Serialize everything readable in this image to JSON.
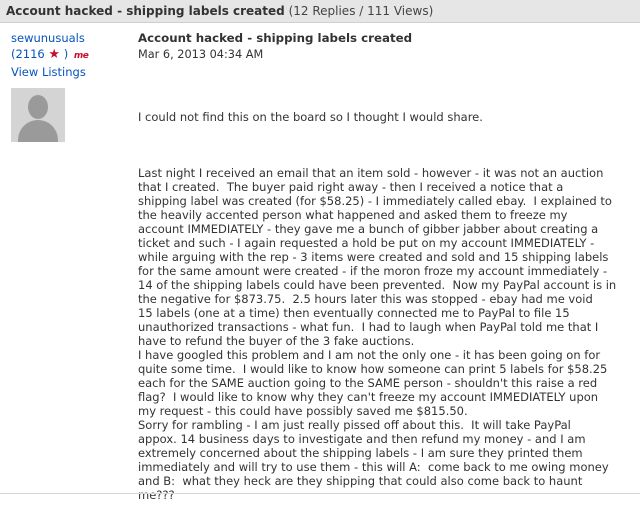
{
  "thread": {
    "title": "Account hacked - shipping labels created",
    "meta": "(12 Replies / 111 Views)"
  },
  "author": {
    "name": "sewunusuals",
    "feedback_open": "(2116 ",
    "star": "★",
    "feedback_close": " )",
    "me_badge": "me",
    "view_listings": "View Listings"
  },
  "post": {
    "title": "Account hacked - shipping labels created",
    "date": "Mar 6, 2013 04:34 AM",
    "paragraphs": [
      "I could not find this on the board so I thought I would share.",
      "Last night I received an email that an item sold - however - it was not an auction\nthat I created.  The buyer paid right away - then I received a notice that a\nshipping label was created (for $58.25) - I immediately called ebay.  I explained to\nthe heavily accented person what happened and asked them to freeze my\naccount IMMEDIATELY - they gave me a bunch of gibber jabber about creating a\nticket and such - I again requested a hold be put on my account IMMEDIATELY -\nwhile arguing with the rep - 3 items were created and sold and 15 shipping labels\nfor the same amount were created - if the moron froze my account immediately -\n14 of the shipping labels could have been prevented.  Now my PayPal account is in\nthe negative for $873.75.  2.5 hours later this was stopped - ebay had me void\n15 labels (one at a time) then eventually connected me to PayPal to file 15\nunauthorized transactions - what fun.  I had to laugh when PayPal told me that I\nhave to refund the buyer of the 3 fake auctions.\nI have googled this problem and I am not the only one - it has been going on for\nquite some time.  I would like to know how someone can print 5 labels for $58.25\neach for the SAME auction going to the SAME person - shouldn't this raise a red\nflag?  I would like to know why they can't freeze my account IMMEDIATELY upon\nmy request - this could have possibly saved me $815.50.\nSorry for rambling - I am just really pissed off about this.  It will take PayPal\nappox. 14 business days to investigate and then refund my money - and I am\nextremely concerned about the shipping labels - I am sure they printed them\nimmediately and will try to use them - this will A:  come back to me owing money\nand B:  what they heck are they shipping that could also come back to haunt\nme???"
    ]
  },
  "icons": {
    "star": "star-icon",
    "avatar": "default-avatar-icon"
  },
  "colors": {
    "link": "#0654ba",
    "header_bg": "#e6e6e6",
    "star": "#c8102e"
  }
}
